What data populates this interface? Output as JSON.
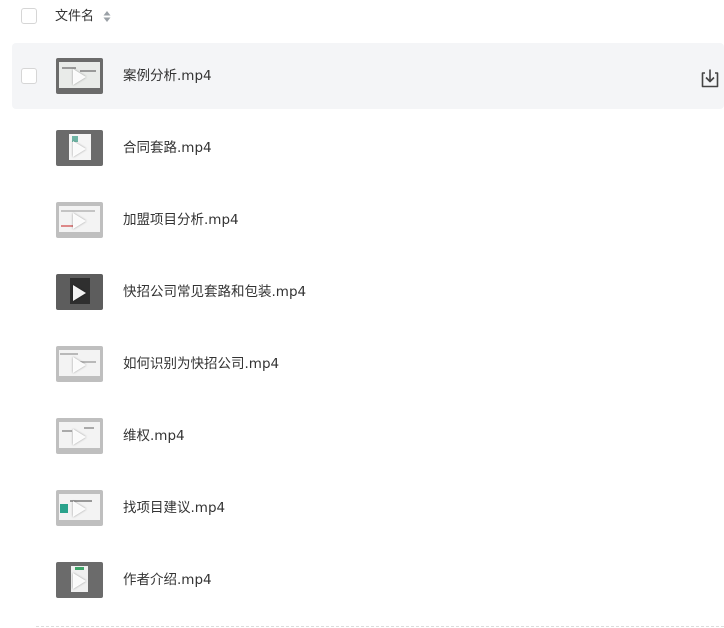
{
  "header": {
    "name_label": "文件名"
  },
  "files": [
    {
      "name": "案例分析.mp4",
      "selected": true
    },
    {
      "name": "合同套路.mp4",
      "selected": false
    },
    {
      "name": "加盟项目分析.mp4",
      "selected": false
    },
    {
      "name": "快招公司常见套路和包装.mp4",
      "selected": false
    },
    {
      "name": "如何识别为快招公司.mp4",
      "selected": false
    },
    {
      "name": "维权.mp4",
      "selected": false
    },
    {
      "name": "找项目建议.mp4",
      "selected": false
    },
    {
      "name": "作者介绍.mp4",
      "selected": false
    }
  ],
  "icons": {
    "sort": "sort-icon",
    "download": "download-icon",
    "play": "play-icon"
  },
  "colors": {
    "selected_row_bg": "#f4f5f7",
    "text": "#333333"
  }
}
